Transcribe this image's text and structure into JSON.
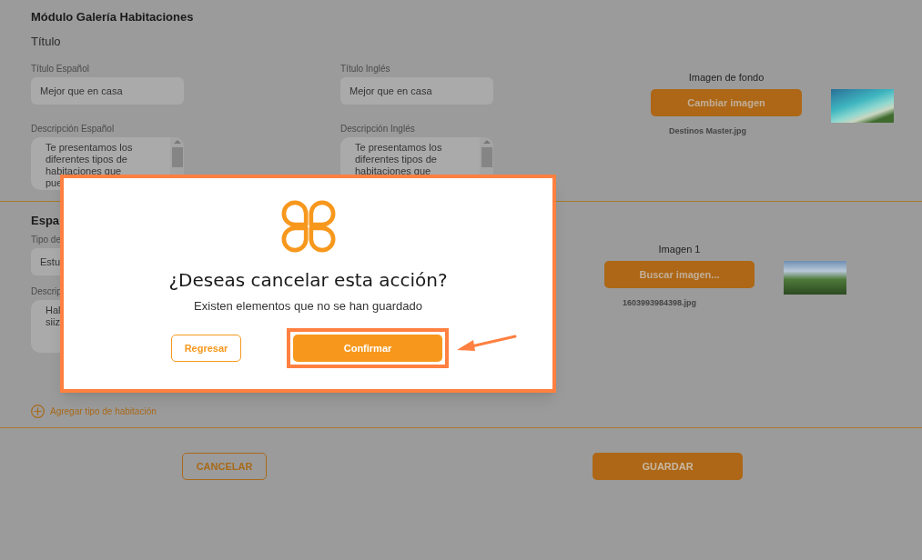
{
  "module": {
    "title": "Módulo Galería Habitaciones",
    "subtitle": "Título",
    "columns": [
      {
        "fields": [
          {
            "kind": "input",
            "label": "Título Español",
            "value": "Mejor que en casa"
          },
          {
            "kind": "textarea",
            "label": "Descripción Español",
            "lines": [
              "Te presentamos los",
              "diferentes tipos de",
              "habitaciones que",
              "pue"
            ]
          }
        ]
      },
      {
        "fields": [
          {
            "kind": "input",
            "label": "Título Inglés",
            "value": "Mejor que en casa"
          },
          {
            "kind": "textarea",
            "label": "Descripción Inglés",
            "lines": [
              "Te presentamos los",
              "diferentes tipos de",
              "habitaciones que"
            ]
          }
        ]
      }
    ],
    "image": {
      "label": "Imagen de fondo",
      "button": "Cambiar imagen",
      "filename": "Destinos Master.jpg"
    }
  },
  "rooms": {
    "title": "Espa",
    "fields": [
      {
        "kind": "input",
        "label": "Tipo de",
        "value": "Estu"
      },
      {
        "kind": "textarea",
        "label": "Descrip",
        "lines": [
          "Hal",
          "siiz"
        ]
      }
    ],
    "image": {
      "label": "Imagen 1",
      "button": "Buscar imagen...",
      "filename": "1603993984398.jpg"
    },
    "add_link": "Agregar tipo de habitación"
  },
  "footer": {
    "cancel": "CANCELAR",
    "save": "GUARDAR"
  },
  "dialog": {
    "title": "¿Deseas cancelar esta acción?",
    "message": "Existen elementos que no se han guardado",
    "back": "Regresar",
    "confirm": "Confirmar"
  }
}
